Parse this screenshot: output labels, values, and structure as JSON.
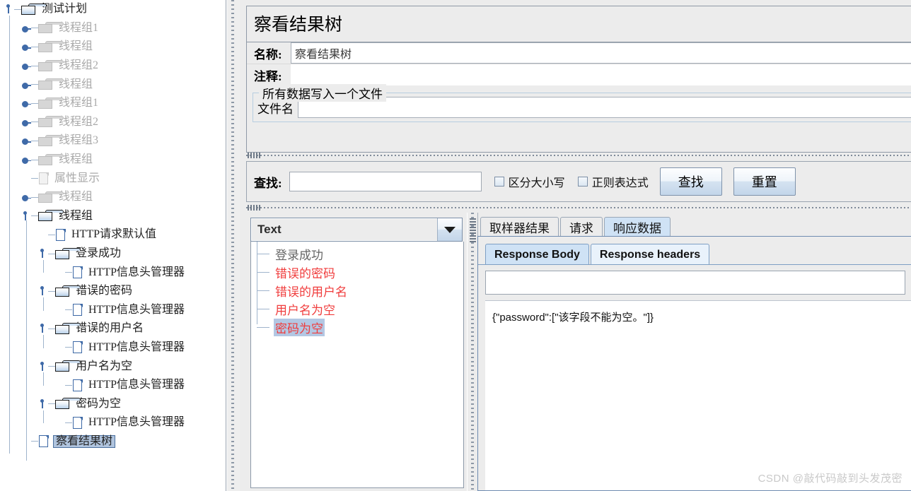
{
  "tree": {
    "root": {
      "label": "测试计划",
      "icon": "folder-icon"
    },
    "items": [
      {
        "label": "线程组1",
        "icon": "folder-icon",
        "state": "collapsed",
        "dim": true,
        "indent": 1
      },
      {
        "label": "线程组",
        "icon": "folder-icon",
        "state": "collapsed",
        "dim": true,
        "indent": 1
      },
      {
        "label": "线程组2",
        "icon": "folder-icon",
        "state": "collapsed",
        "dim": true,
        "indent": 1
      },
      {
        "label": "线程组",
        "icon": "folder-icon",
        "state": "collapsed",
        "dim": true,
        "indent": 1
      },
      {
        "label": "线程组1",
        "icon": "folder-icon",
        "state": "collapsed",
        "dim": true,
        "indent": 1
      },
      {
        "label": "线程组2",
        "icon": "folder-icon",
        "state": "collapsed",
        "dim": true,
        "indent": 1
      },
      {
        "label": "线程组3",
        "icon": "folder-icon",
        "state": "collapsed",
        "dim": true,
        "indent": 1
      },
      {
        "label": "线程组",
        "icon": "folder-icon",
        "state": "collapsed",
        "dim": true,
        "indent": 1
      },
      {
        "label": "属性显示",
        "icon": "file-icon",
        "state": "leaf",
        "dim": true,
        "indent": 1
      },
      {
        "label": "线程组",
        "icon": "folder-icon",
        "state": "collapsed",
        "dim": true,
        "indent": 1
      },
      {
        "label": "线程组",
        "icon": "folder-icon",
        "state": "expanded",
        "dim": false,
        "indent": 1
      },
      {
        "label": "HTTP请求默认值",
        "icon": "file-icon",
        "state": "leaf",
        "dim": false,
        "indent": 2
      },
      {
        "label": "登录成功",
        "icon": "folder-icon",
        "state": "expanded",
        "dim": false,
        "indent": 2
      },
      {
        "label": "HTTP信息头管理器",
        "icon": "file-icon",
        "state": "leaf",
        "dim": false,
        "indent": 3
      },
      {
        "label": "错误的密码",
        "icon": "folder-icon",
        "state": "expanded",
        "dim": false,
        "indent": 2
      },
      {
        "label": "HTTP信息头管理器",
        "icon": "file-icon",
        "state": "leaf",
        "dim": false,
        "indent": 3
      },
      {
        "label": "错误的用户名",
        "icon": "folder-icon",
        "state": "expanded",
        "dim": false,
        "indent": 2
      },
      {
        "label": "HTTP信息头管理器",
        "icon": "file-icon",
        "state": "leaf",
        "dim": false,
        "indent": 3
      },
      {
        "label": "用户名为空",
        "icon": "folder-icon",
        "state": "expanded",
        "dim": false,
        "indent": 2
      },
      {
        "label": "HTTP信息头管理器",
        "icon": "file-icon",
        "state": "leaf",
        "dim": false,
        "indent": 3
      },
      {
        "label": "密码为空",
        "icon": "folder-icon",
        "state": "expanded",
        "dim": false,
        "indent": 2
      },
      {
        "label": "HTTP信息头管理器",
        "icon": "file-icon",
        "state": "leaf",
        "dim": false,
        "indent": 3
      },
      {
        "label": "察看结果树",
        "icon": "file-icon",
        "state": "leaf",
        "dim": false,
        "indent": 1,
        "selected": true
      }
    ]
  },
  "panel": {
    "title": "察看结果树",
    "name_label": "名称:",
    "name_value": "察看结果树",
    "comment_label": "注释:",
    "comment_value": "",
    "groupbox_legend": "所有数据写入一个文件",
    "filename_label": "文件名",
    "filename_value": ""
  },
  "search": {
    "label": "查找:",
    "value": "",
    "case_sensitive_label": "区分大小写",
    "case_sensitive_checked": false,
    "regex_label": "正则表达式",
    "regex_checked": false,
    "find_button": "查找",
    "reset_button": "重置"
  },
  "results": {
    "renderer_selected": "Text",
    "rows": [
      {
        "label": "登录成功",
        "status": "ok",
        "selected": false
      },
      {
        "label": "错误的密码",
        "status": "err",
        "selected": false
      },
      {
        "label": "错误的用户名",
        "status": "err",
        "selected": false
      },
      {
        "label": "用户名为空",
        "status": "err",
        "selected": false
      },
      {
        "label": "密码为空",
        "status": "err",
        "selected": true
      }
    ]
  },
  "detail": {
    "outer_tabs": [
      {
        "label": "取样器结果",
        "active": false
      },
      {
        "label": "请求",
        "active": false
      },
      {
        "label": "响应数据",
        "active": true
      }
    ],
    "inner_tabs": [
      {
        "label": "Response Body",
        "active": true
      },
      {
        "label": "Response headers",
        "active": false
      }
    ],
    "find_value": "",
    "body_text": "{\"password\":[\"该字段不能为空。\"]}"
  },
  "watermark": "CSDN @敲代码敲到头发茂密",
  "colors": {
    "panel_bg": "#ececec",
    "accent_blue": "#3f6aa8",
    "selection": "#b0c4de",
    "error_red": "#f03c3c",
    "tab_active": "#cfe2f5"
  }
}
